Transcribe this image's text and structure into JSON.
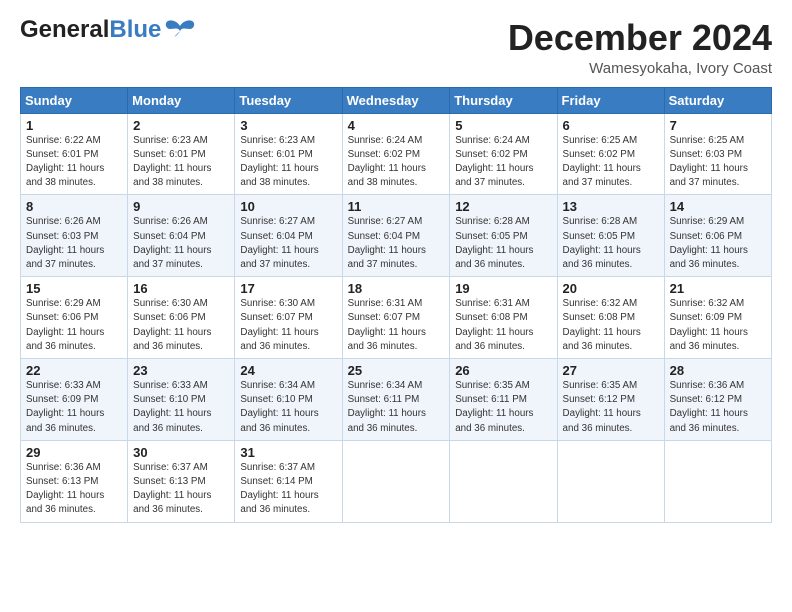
{
  "header": {
    "logo_general": "General",
    "logo_blue": "Blue",
    "title": "December 2024",
    "subtitle": "Wamesyokaha, Ivory Coast"
  },
  "calendar": {
    "days_of_week": [
      "Sunday",
      "Monday",
      "Tuesday",
      "Wednesday",
      "Thursday",
      "Friday",
      "Saturday"
    ],
    "weeks": [
      [
        {
          "day": "1",
          "info": "Sunrise: 6:22 AM\nSunset: 6:01 PM\nDaylight: 11 hours\nand 38 minutes."
        },
        {
          "day": "2",
          "info": "Sunrise: 6:23 AM\nSunset: 6:01 PM\nDaylight: 11 hours\nand 38 minutes."
        },
        {
          "day": "3",
          "info": "Sunrise: 6:23 AM\nSunset: 6:01 PM\nDaylight: 11 hours\nand 38 minutes."
        },
        {
          "day": "4",
          "info": "Sunrise: 6:24 AM\nSunset: 6:02 PM\nDaylight: 11 hours\nand 38 minutes."
        },
        {
          "day": "5",
          "info": "Sunrise: 6:24 AM\nSunset: 6:02 PM\nDaylight: 11 hours\nand 37 minutes."
        },
        {
          "day": "6",
          "info": "Sunrise: 6:25 AM\nSunset: 6:02 PM\nDaylight: 11 hours\nand 37 minutes."
        },
        {
          "day": "7",
          "info": "Sunrise: 6:25 AM\nSunset: 6:03 PM\nDaylight: 11 hours\nand 37 minutes."
        }
      ],
      [
        {
          "day": "8",
          "info": "Sunrise: 6:26 AM\nSunset: 6:03 PM\nDaylight: 11 hours\nand 37 minutes."
        },
        {
          "day": "9",
          "info": "Sunrise: 6:26 AM\nSunset: 6:04 PM\nDaylight: 11 hours\nand 37 minutes."
        },
        {
          "day": "10",
          "info": "Sunrise: 6:27 AM\nSunset: 6:04 PM\nDaylight: 11 hours\nand 37 minutes."
        },
        {
          "day": "11",
          "info": "Sunrise: 6:27 AM\nSunset: 6:04 PM\nDaylight: 11 hours\nand 37 minutes."
        },
        {
          "day": "12",
          "info": "Sunrise: 6:28 AM\nSunset: 6:05 PM\nDaylight: 11 hours\nand 36 minutes."
        },
        {
          "day": "13",
          "info": "Sunrise: 6:28 AM\nSunset: 6:05 PM\nDaylight: 11 hours\nand 36 minutes."
        },
        {
          "day": "14",
          "info": "Sunrise: 6:29 AM\nSunset: 6:06 PM\nDaylight: 11 hours\nand 36 minutes."
        }
      ],
      [
        {
          "day": "15",
          "info": "Sunrise: 6:29 AM\nSunset: 6:06 PM\nDaylight: 11 hours\nand 36 minutes."
        },
        {
          "day": "16",
          "info": "Sunrise: 6:30 AM\nSunset: 6:06 PM\nDaylight: 11 hours\nand 36 minutes."
        },
        {
          "day": "17",
          "info": "Sunrise: 6:30 AM\nSunset: 6:07 PM\nDaylight: 11 hours\nand 36 minutes."
        },
        {
          "day": "18",
          "info": "Sunrise: 6:31 AM\nSunset: 6:07 PM\nDaylight: 11 hours\nand 36 minutes."
        },
        {
          "day": "19",
          "info": "Sunrise: 6:31 AM\nSunset: 6:08 PM\nDaylight: 11 hours\nand 36 minutes."
        },
        {
          "day": "20",
          "info": "Sunrise: 6:32 AM\nSunset: 6:08 PM\nDaylight: 11 hours\nand 36 minutes."
        },
        {
          "day": "21",
          "info": "Sunrise: 6:32 AM\nSunset: 6:09 PM\nDaylight: 11 hours\nand 36 minutes."
        }
      ],
      [
        {
          "day": "22",
          "info": "Sunrise: 6:33 AM\nSunset: 6:09 PM\nDaylight: 11 hours\nand 36 minutes."
        },
        {
          "day": "23",
          "info": "Sunrise: 6:33 AM\nSunset: 6:10 PM\nDaylight: 11 hours\nand 36 minutes."
        },
        {
          "day": "24",
          "info": "Sunrise: 6:34 AM\nSunset: 6:10 PM\nDaylight: 11 hours\nand 36 minutes."
        },
        {
          "day": "25",
          "info": "Sunrise: 6:34 AM\nSunset: 6:11 PM\nDaylight: 11 hours\nand 36 minutes."
        },
        {
          "day": "26",
          "info": "Sunrise: 6:35 AM\nSunset: 6:11 PM\nDaylight: 11 hours\nand 36 minutes."
        },
        {
          "day": "27",
          "info": "Sunrise: 6:35 AM\nSunset: 6:12 PM\nDaylight: 11 hours\nand 36 minutes."
        },
        {
          "day": "28",
          "info": "Sunrise: 6:36 AM\nSunset: 6:12 PM\nDaylight: 11 hours\nand 36 minutes."
        }
      ],
      [
        {
          "day": "29",
          "info": "Sunrise: 6:36 AM\nSunset: 6:13 PM\nDaylight: 11 hours\nand 36 minutes."
        },
        {
          "day": "30",
          "info": "Sunrise: 6:37 AM\nSunset: 6:13 PM\nDaylight: 11 hours\nand 36 minutes."
        },
        {
          "day": "31",
          "info": "Sunrise: 6:37 AM\nSunset: 6:14 PM\nDaylight: 11 hours\nand 36 minutes."
        },
        {
          "day": "",
          "info": ""
        },
        {
          "day": "",
          "info": ""
        },
        {
          "day": "",
          "info": ""
        },
        {
          "day": "",
          "info": ""
        }
      ]
    ]
  }
}
